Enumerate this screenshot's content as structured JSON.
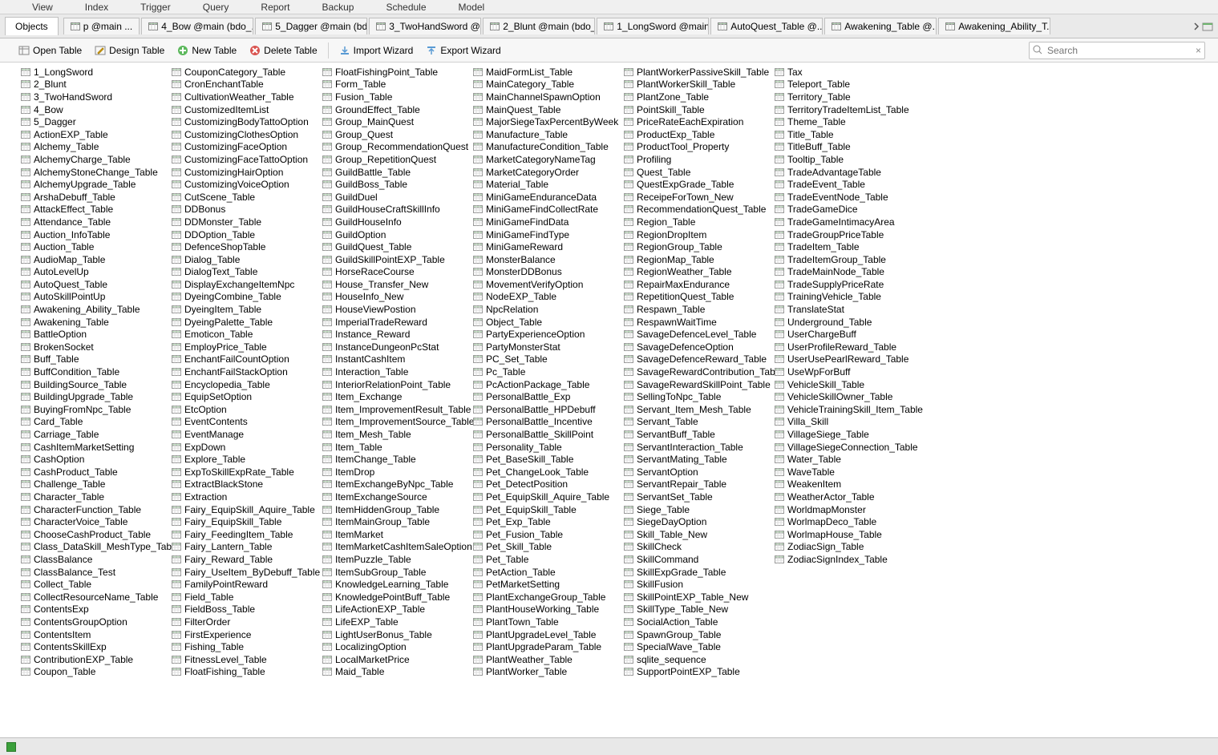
{
  "menu": [
    "View",
    "Index",
    "Trigger",
    "Query",
    "Report",
    "Backup",
    "Schedule",
    "Model"
  ],
  "sideTab": "Objects",
  "tabs": [
    "p @main ...",
    "4_Bow @main (bdo_...",
    "5_Dagger @main (bd...",
    "3_TwoHandSword @...",
    "2_Blunt @main (bdo_...",
    "1_LongSword @main...",
    "AutoQuest_Table @...",
    "Awakening_Table @...",
    "Awakening_Ability_T..."
  ],
  "toolbar": {
    "open": "Open Table",
    "design": "Design Table",
    "new": "New Table",
    "delete": "Delete Table",
    "import": "Import Wizard",
    "export": "Export Wizard"
  },
  "searchPlaceholder": "Search",
  "columns": [
    [
      "1_LongSword",
      "2_Blunt",
      "3_TwoHandSword",
      "4_Bow",
      "5_Dagger",
      "ActionEXP_Table",
      "Alchemy_Table",
      "AlchemyCharge_Table",
      "AlchemyStoneChange_Table",
      "AlchemyUpgrade_Table",
      "ArshaDebuff_Table",
      "AttackEffect_Table",
      "Attendance_Table",
      "Auction_InfoTable",
      "Auction_Table",
      "AudioMap_Table",
      "AutoLevelUp",
      "AutoQuest_Table",
      "AutoSkillPointUp",
      "Awakening_Ability_Table",
      "Awakening_Table",
      "BattleOption",
      "BrokenSocket",
      "Buff_Table",
      "BuffCondition_Table",
      "BuildingSource_Table",
      "BuildingUpgrade_Table",
      "BuyingFromNpc_Table",
      "Card_Table",
      "Carriage_Table",
      "CashItemMarketSetting",
      "CashOption",
      "CashProduct_Table",
      "Challenge_Table",
      "Character_Table",
      "CharacterFunction_Table",
      "CharacterVoice_Table",
      "ChooseCashProduct_Table",
      "Class_DataSkill_MeshType_Table",
      "ClassBalance",
      "ClassBalance_Test",
      "Collect_Table",
      "CollectResourceName_Table",
      "ContentsExp",
      "ContentsGroupOption",
      "ContentsItem",
      "ContentsSkillExp",
      "ContributionEXP_Table",
      "Coupon_Table"
    ],
    [
      "CouponCategory_Table",
      "CronEnchantTable",
      "CultivationWeather_Table",
      "CustomizedItemList",
      "CustomizingBodyTattoOption",
      "CustomizingClothesOption",
      "CustomizingFaceOption",
      "CustomizingFaceTattoOption",
      "CustomizingHairOption",
      "CustomizingVoiceOption",
      "CutScene_Table",
      "DDBonus",
      "DDMonster_Table",
      "DDOption_Table",
      "DefenceShopTable",
      "Dialog_Table",
      "DialogText_Table",
      "DisplayExchangeItemNpc",
      "DyeingCombine_Table",
      "DyeingItem_Table",
      "DyeingPalette_Table",
      "Emoticon_Table",
      "EmployPrice_Table",
      "EnchantFailCountOption",
      "EnchantFailStackOption",
      "Encyclopedia_Table",
      "EquipSetOption",
      "EtcOption",
      "EventContents",
      "EventManage",
      "ExpDown",
      "Explore_Table",
      "ExpToSkillExpRate_Table",
      "ExtractBlackStone",
      "Extraction",
      "Fairy_EquipSkill_Aquire_Table",
      "Fairy_EquipSkill_Table",
      "Fairy_FeedingItem_Table",
      "Fairy_Lantern_Table",
      "Fairy_Reward_Table",
      "Fairy_UseItem_ByDebuff_Table",
      "FamilyPointReward",
      "Field_Table",
      "FieldBoss_Table",
      "FilterOrder",
      "FirstExperience",
      "Fishing_Table",
      "FitnessLevel_Table",
      "FloatFishing_Table"
    ],
    [
      "FloatFishingPoint_Table",
      "Form_Table",
      "Fusion_Table",
      "GroundEffect_Table",
      "Group_MainQuest",
      "Group_Quest",
      "Group_RecommendationQuest",
      "Group_RepetitionQuest",
      "GuildBattle_Table",
      "GuildBoss_Table",
      "GuildDuel",
      "GuildHouseCraftSkillInfo",
      "GuildHouseInfo",
      "GuildOption",
      "GuildQuest_Table",
      "GuildSkillPointEXP_Table",
      "HorseRaceCourse",
      "House_Transfer_New",
      "HouseInfo_New",
      "HouseViewPostion",
      "ImperialTradeReward",
      "Instance_Reward",
      "InstanceDungeonPcStat",
      "InstantCashItem",
      "Interaction_Table",
      "InteriorRelationPoint_Table",
      "Item_Exchange",
      "Item_ImprovementResult_Table",
      "Item_ImprovementSource_Table",
      "Item_Mesh_Table",
      "Item_Table",
      "ItemChange_Table",
      "ItemDrop",
      "ItemExchangeByNpc_Table",
      "ItemExchangeSource",
      "ItemHiddenGroup_Table",
      "ItemMainGroup_Table",
      "ItemMarket",
      "ItemMarketCashItemSaleOption",
      "ItemPuzzle_Table",
      "ItemSubGroup_Table",
      "KnowledgeLearning_Table",
      "KnowledgePointBuff_Table",
      "LifeActionEXP_Table",
      "LifeEXP_Table",
      "LightUserBonus_Table",
      "LocalizingOption",
      "LocalMarketPrice",
      "Maid_Table"
    ],
    [
      "MaidFormList_Table",
      "MainCategory_Table",
      "MainChannelSpawnOption",
      "MainQuest_Table",
      "MajorSiegeTaxPercentByWeek",
      "Manufacture_Table",
      "ManufactureCondition_Table",
      "MarketCategoryNameTag",
      "MarketCategoryOrder",
      "Material_Table",
      "MiniGameEnduranceData",
      "MiniGameFindCollectRate",
      "MiniGameFindData",
      "MiniGameFindType",
      "MiniGameReward",
      "MonsterBalance",
      "MonsterDDBonus",
      "MovementVerifyOption",
      "NodeEXP_Table",
      "NpcRelation",
      "Object_Table",
      "PartyExperienceOption",
      "PartyMonsterStat",
      "PC_Set_Table",
      "Pc_Table",
      "PcActionPackage_Table",
      "PersonalBattle_Exp",
      "PersonalBattle_HPDebuff",
      "PersonalBattle_Incentive",
      "PersonalBattle_SkillPoint",
      "Personality_Table",
      "Pet_BaseSkill_Table",
      "Pet_ChangeLook_Table",
      "Pet_DetectPosition",
      "Pet_EquipSkill_Aquire_Table",
      "Pet_EquipSkill_Table",
      "Pet_Exp_Table",
      "Pet_Fusion_Table",
      "Pet_Skill_Table",
      "Pet_Table",
      "PetAction_Table",
      "PetMarketSetting",
      "PlantExchangeGroup_Table",
      "PlantHouseWorking_Table",
      "PlantTown_Table",
      "PlantUpgradeLevel_Table",
      "PlantUpgradeParam_Table",
      "PlantWeather_Table",
      "PlantWorker_Table"
    ],
    [
      "PlantWorkerPassiveSkill_Table",
      "PlantWorkerSkill_Table",
      "PlantZone_Table",
      "PointSkill_Table",
      "PriceRateEachExpiration",
      "ProductExp_Table",
      "ProductTool_Property",
      "Profiling",
      "Quest_Table",
      "QuestExpGrade_Table",
      "ReceipeForTown_New",
      "RecommendationQuest_Table",
      "Region_Table",
      "RegionDropItem",
      "RegionGroup_Table",
      "RegionMap_Table",
      "RegionWeather_Table",
      "RepairMaxEndurance",
      "RepetitionQuest_Table",
      "Respawn_Table",
      "RespawnWaitTime",
      "SavageDefenceLevel_Table",
      "SavageDefenceOption",
      "SavageDefenceReward_Table",
      "SavageRewardContribution_Table",
      "SavageRewardSkillPoint_Table",
      "SellingToNpc_Table",
      "Servant_Item_Mesh_Table",
      "Servant_Table",
      "ServantBuff_Table",
      "ServantInteraction_Table",
      "ServantMating_Table",
      "ServantOption",
      "ServantRepair_Table",
      "ServantSet_Table",
      "Siege_Table",
      "SiegeDayOption",
      "Skill_Table_New",
      "SkillCheck",
      "SkillCommand",
      "SkillExpGrade_Table",
      "SkillFusion",
      "SkillPointEXP_Table_New",
      "SkillType_Table_New",
      "SocialAction_Table",
      "SpawnGroup_Table",
      "SpecialWave_Table",
      "sqlite_sequence",
      "SupportPointEXP_Table"
    ],
    [
      "Tax",
      "Teleport_Table",
      "Territory_Table",
      "TerritoryTradeItemList_Table",
      "Theme_Table",
      "Title_Table",
      "TitleBuff_Table",
      "Tooltip_Table",
      "TradeAdvantageTable",
      "TradeEvent_Table",
      "TradeEventNode_Table",
      "TradeGameDice",
      "TradeGameIntimacyArea",
      "TradeGroupPriceTable",
      "TradeItem_Table",
      "TradeItemGroup_Table",
      "TradeMainNode_Table",
      "TradeSupplyPriceRate",
      "TrainingVehicle_Table",
      "TranslateStat",
      "Underground_Table",
      "UserChargeBuff",
      "UserProfileReward_Table",
      "UserUsePearlReward_Table",
      "UseWpForBuff",
      "VehicleSkill_Table",
      "VehicleSkillOwner_Table",
      "VehicleTrainingSkill_Item_Table",
      "Villa_Skill",
      "VillageSiege_Table",
      "VillageSiegeConnection_Table",
      "Water_Table",
      "WaveTable",
      "WeakenItem",
      "WeatherActor_Table",
      "WorldmapMonster",
      "WorlmapDeco_Table",
      "WorlmapHouse_Table",
      "ZodiacSign_Table",
      "ZodiacSignIndex_Table"
    ]
  ]
}
